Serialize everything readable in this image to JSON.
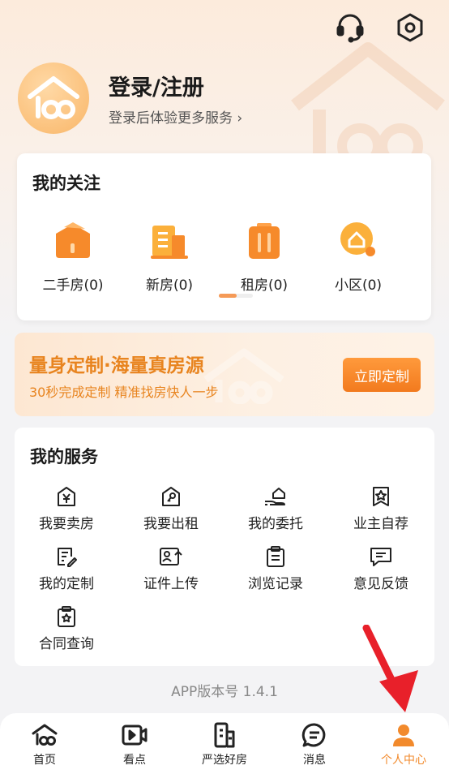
{
  "header": {
    "login_title": "登录/注册",
    "login_subtitle": "登录后体验更多服务 ›",
    "icons": [
      "headset-icon",
      "settings-hexagon-icon"
    ]
  },
  "follow": {
    "title": "我的关注",
    "items": [
      {
        "label": "二手房(0)",
        "icon": "secondhand-house-icon"
      },
      {
        "label": "新房(0)",
        "icon": "new-building-icon"
      },
      {
        "label": "租房(0)",
        "icon": "rental-icon"
      },
      {
        "label": "小区(0)",
        "icon": "community-pin-icon"
      }
    ]
  },
  "banner": {
    "title": "量身定制·海量真房源",
    "subtitle": "30秒完成定制 精准找房快人一步",
    "button": "立即定制"
  },
  "services": {
    "title": "我的服务",
    "items": [
      {
        "label": "我要卖房",
        "icon": "house-yen-icon"
      },
      {
        "label": "我要出租",
        "icon": "house-key-icon"
      },
      {
        "label": "我的委托",
        "icon": "hand-house-icon"
      },
      {
        "label": "业主自荐",
        "icon": "star-badge-icon"
      },
      {
        "label": "我的定制",
        "icon": "document-edit-icon"
      },
      {
        "label": "证件上传",
        "icon": "id-upload-icon"
      },
      {
        "label": "浏览记录",
        "icon": "clipboard-icon"
      },
      {
        "label": "意见反馈",
        "icon": "feedback-icon"
      },
      {
        "label": "合同查询",
        "icon": "contract-star-icon"
      }
    ]
  },
  "version": "APP版本号 1.4.1",
  "tabbar": {
    "items": [
      {
        "label": "首页",
        "icon": "home-icon"
      },
      {
        "label": "看点",
        "icon": "video-icon"
      },
      {
        "label": "严选好房",
        "icon": "building-icon"
      },
      {
        "label": "消息",
        "icon": "message-icon"
      },
      {
        "label": "个人中心",
        "icon": "person-icon"
      }
    ],
    "active_index": 4,
    "active_color": "#f28a2c"
  },
  "colors": {
    "accent": "#f28a2c",
    "banner_text": "#e8841f",
    "annotation_arrow": "#e8202a"
  }
}
